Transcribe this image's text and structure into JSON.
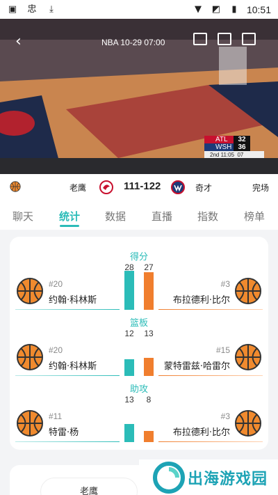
{
  "status_bar": {
    "time": "10:51",
    "left_icons": [
      "gallery-icon",
      "app-icon",
      "download-icon"
    ],
    "right_icons": [
      "wifi-icon",
      "no-signal-icon",
      "battery-icon"
    ]
  },
  "video": {
    "title": "NBA  10-29 07:00",
    "scorebug": {
      "team1": "ATL",
      "score1": "32",
      "team2": "WSH",
      "score2": "36",
      "quarter": "2nd",
      "clock": "11:05",
      "shot_clock": "07"
    }
  },
  "match": {
    "home_team": "老鹰",
    "score": "111-122",
    "away_team": "奇才",
    "status": "完场",
    "colors": {
      "home": "#c8102e",
      "away": "#1d3a78"
    }
  },
  "tabs": [
    {
      "label": "聊天",
      "active": false
    },
    {
      "label": "统计",
      "active": true
    },
    {
      "label": "数据",
      "active": false
    },
    {
      "label": "直播",
      "active": false
    },
    {
      "label": "指数",
      "active": false
    },
    {
      "label": "榜单",
      "active": false
    }
  ],
  "stats": [
    {
      "title": "得分",
      "home_value": 28,
      "away_value": 27,
      "home_player": {
        "number": "#20",
        "name": "约翰·科林斯"
      },
      "away_player": {
        "number": "#3",
        "name": "布拉德利·比尔"
      }
    },
    {
      "title": "篮板",
      "home_value": 12,
      "away_value": 13,
      "home_player": {
        "number": "#20",
        "name": "约翰·科林斯"
      },
      "away_player": {
        "number": "#15",
        "name": "蒙特雷兹·哈雷尔"
      }
    },
    {
      "title": "助攻",
      "home_value": 13,
      "away_value": 8,
      "home_player": {
        "number": "#11",
        "name": "特雷·杨"
      },
      "away_player": {
        "number": "#3",
        "name": "布拉德利·比尔"
      }
    }
  ],
  "bottom": {
    "pill_label": "老鹰"
  },
  "watermark": {
    "text": "出海游戏园"
  },
  "theme": {
    "accent": "#2bbcb8",
    "away_bar": "#f07e2e"
  }
}
